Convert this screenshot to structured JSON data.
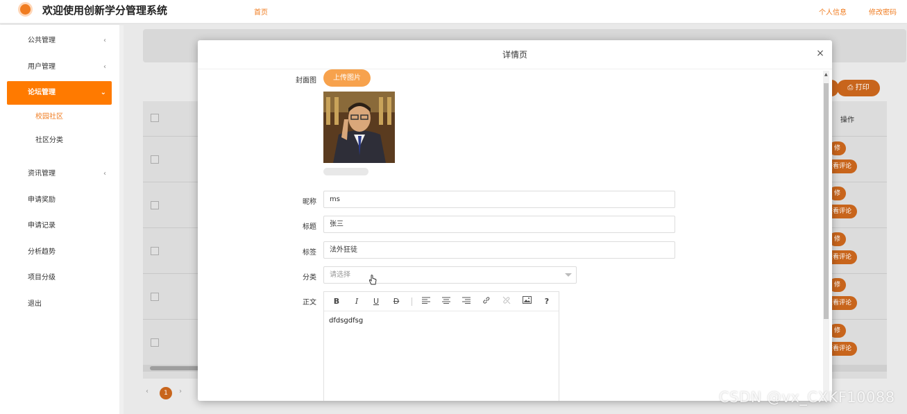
{
  "header": {
    "title": "欢迎使用创新学分管理系统",
    "home": "首页",
    "profile": "个人信息",
    "change_password": "修改密码"
  },
  "sidebar": {
    "items": [
      {
        "label": "公共管理",
        "has_children": true
      },
      {
        "label": "用户管理",
        "has_children": true
      },
      {
        "label": "论坛管理",
        "has_children": true,
        "active": true,
        "children": [
          {
            "label": "校园社区",
            "active": true
          },
          {
            "label": "社区分类"
          }
        ]
      },
      {
        "label": "资讯管理",
        "has_children": true
      },
      {
        "label": "申请奖励"
      },
      {
        "label": "申请记录"
      },
      {
        "label": "分析趋势"
      },
      {
        "label": "项目分级"
      },
      {
        "label": "退出"
      }
    ]
  },
  "background": {
    "print_label": "打印",
    "op_header": "操作",
    "row_btn_edit": "修",
    "row_btn_view": "查看评论",
    "current_page": "1"
  },
  "modal": {
    "title": "详情页",
    "close": "×",
    "cover": {
      "label": "封面图",
      "upload_label": "上传图片"
    },
    "nickname": {
      "label": "昵称",
      "value": "ms"
    },
    "title_field": {
      "label": "标题",
      "value": "张三"
    },
    "tag": {
      "label": "标签",
      "value": "法外狂徒"
    },
    "category": {
      "label": "分类",
      "placeholder": "请选择"
    },
    "body": {
      "label": "正文",
      "content": "dfdsgdfsg"
    },
    "toolbar": {
      "bold": "B",
      "italic": "I",
      "underline": "U",
      "strike": "D",
      "help": "?"
    }
  },
  "watermark": "CSDN @vx_CXKF10088",
  "colors": {
    "accent": "#ff7a00",
    "upload_button": "#f7a24d"
  }
}
